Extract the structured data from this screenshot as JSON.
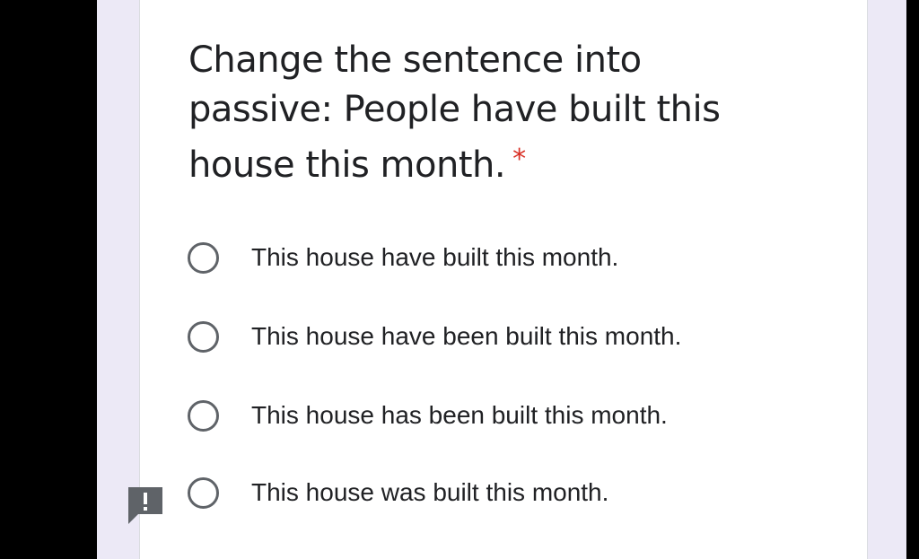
{
  "question": {
    "text": "Change the sentence into passive: People have built this house this month.",
    "required_marker": "*"
  },
  "options": [
    {
      "label": "This house have built this month.",
      "selected": false
    },
    {
      "label": "This house have been built this month.",
      "selected": false
    },
    {
      "label": "This house has been built this month.",
      "selected": false
    },
    {
      "label": "This house was built this month.",
      "selected": false
    }
  ],
  "icons": {
    "feedback": "feedback-alert-icon"
  },
  "colors": {
    "page_background": "#ece9f6",
    "card_background": "#ffffff",
    "required_star": "#d93025",
    "radio_border": "#5f6368",
    "text": "#202124"
  }
}
